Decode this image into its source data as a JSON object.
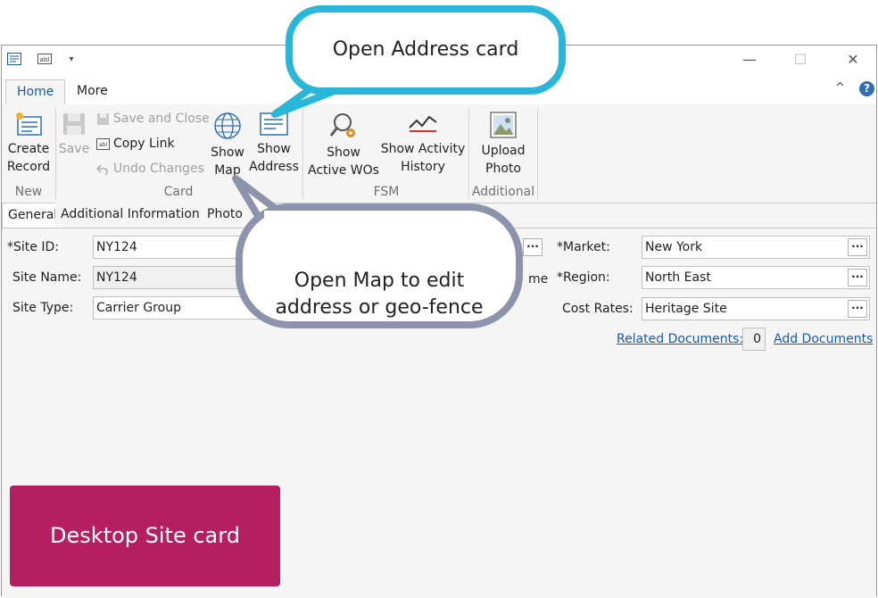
{
  "ribbon_tabs": [
    {
      "label": "Home",
      "active": true
    },
    {
      "label": "More",
      "active": false
    }
  ],
  "ribbon": {
    "create_record": "Create\nRecord",
    "save": "Save",
    "save_and_close": "Save and Close",
    "copy_link": "Copy Link",
    "undo_changes": "Undo Changes",
    "show_map": "Show\nMap",
    "show_address": "Show\nAddress",
    "show_active_wos": "Show\nActive WOs",
    "show_activity_history": "Show Activity\nHistory",
    "upload_photo": "Upload\nPhoto",
    "groups": {
      "new": "New",
      "card": "Card",
      "fsm": "FSM",
      "additional": "Additional"
    }
  },
  "form_tabs": [
    {
      "label": "General",
      "active": true
    },
    {
      "label": "Additional Information",
      "active": false
    },
    {
      "label": "Photo",
      "active": false
    }
  ],
  "form": {
    "site_id_label": "*Site ID:",
    "site_id_value": "NY124",
    "site_name_label": "Site Name:",
    "site_name_value": "NY124",
    "site_type_label": "Site Type:",
    "site_type_value": "Carrier Group",
    "partial_label": "me",
    "market_label": "*Market:",
    "market_value": "New York",
    "region_label": "*Region:",
    "region_value": "North East",
    "cost_rates_label": "Cost Rates:",
    "cost_rates_value": "Heritage Site",
    "related_documents": "Related Documents:",
    "related_count": "0",
    "add_documents": "Add Documents",
    "ellipsis": "···"
  },
  "callouts": {
    "address": "Open Address card",
    "map": "Open Map to edit\naddress or geo-fence",
    "desktop": "Desktop Site card"
  },
  "colors": {
    "callout_cyan": "#29b6d8",
    "callout_slate": "#8b93ad",
    "card_pink": "#b51f5f",
    "accent_blue": "#1a5aa8"
  },
  "window_controls": {
    "minimize": "—",
    "maximize": "☐",
    "close": "✕"
  },
  "help_icon": "?",
  "collapse_icon": "^"
}
